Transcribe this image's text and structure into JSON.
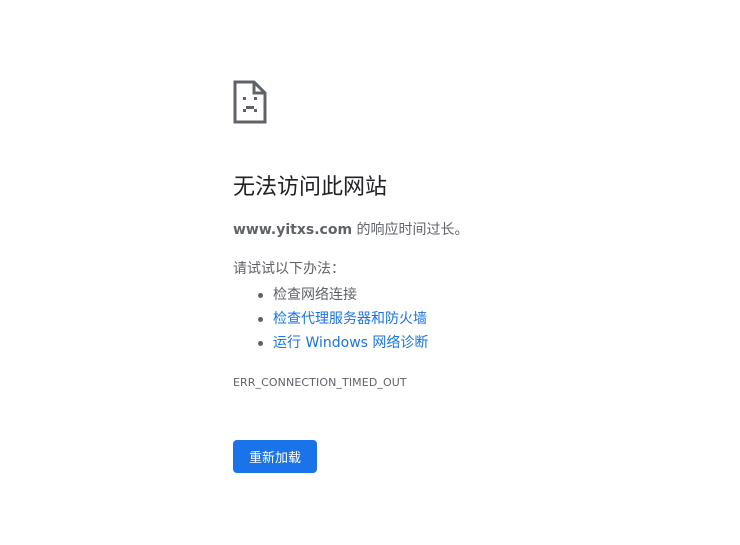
{
  "error": {
    "icon": "sad-document-icon",
    "title": "无法访问此网站",
    "summary_domain": "www.yitxs.com",
    "summary_text": " 的响应时间过长。",
    "suggestions_intro": "请试试以下办法：",
    "suggestions": [
      {
        "label": "检查网络连接",
        "is_link": false
      },
      {
        "label": "检查代理服务器和防火墙",
        "is_link": true
      },
      {
        "label": "运行 Windows 网络诊断",
        "is_link": true
      }
    ],
    "code": "ERR_CONNECTION_TIMED_OUT",
    "reload_label": "重新加载"
  },
  "colors": {
    "accent": "#1a73e8",
    "text_secondary": "#5f6368",
    "text_primary": "#202124",
    "background": "#ffffff"
  }
}
